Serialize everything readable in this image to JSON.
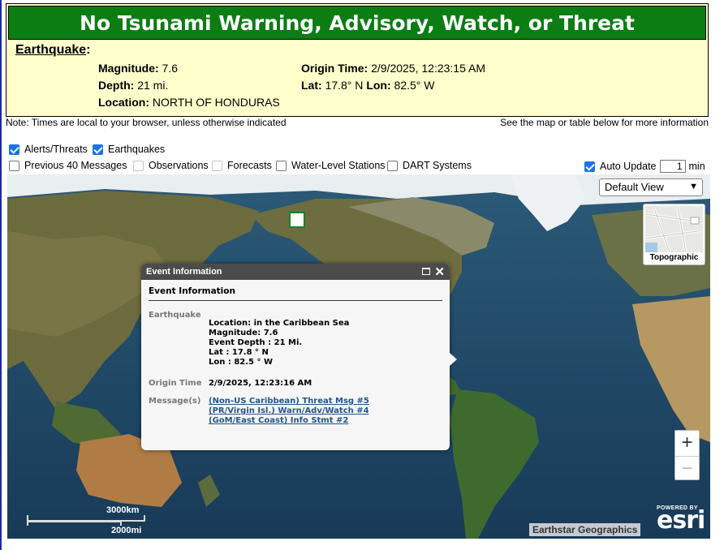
{
  "banner": {
    "title": "No Tsunami Warning, Advisory, Watch, or Threat",
    "earthquake_label": "Earthquake",
    "magnitude_label": "Magnitude:",
    "magnitude": "7.6",
    "depth_label": "Depth:",
    "depth": "21 mi.",
    "location_label": "Location:",
    "location": "NORTH OF HONDURAS",
    "origin_time_label": "Origin Time:",
    "origin_time": "2/9/2025, 12:23:15 AM",
    "lat_label": "Lat:",
    "lat": "17.8° N",
    "lon_label": "Lon:",
    "lon": "82.5° W"
  },
  "notes": {
    "left": "Note: Times are local to your browser, unless otherwise indicated",
    "right": "See the map or table below for more information"
  },
  "layers": {
    "alerts": {
      "label": "Alerts/Threats",
      "checked": true
    },
    "earthquakes": {
      "label": "Earthquakes",
      "checked": true
    },
    "previous": {
      "label": "Previous 40 Messages",
      "checked": false
    },
    "observations": {
      "label": "Observations",
      "checked": false
    },
    "forecasts": {
      "label": "Forecasts",
      "checked": false
    },
    "water_level": {
      "label": "Water-Level Stations",
      "checked": false
    },
    "dart": {
      "label": "DART Systems",
      "checked": false
    }
  },
  "auto_update": {
    "label": "Auto Update",
    "checked": true,
    "value": "1",
    "unit": "min"
  },
  "map": {
    "basemap_selected": "Default View",
    "topo_label": "Topographic",
    "zoom_in": "+",
    "zoom_out": "−",
    "scale_km": "3000km",
    "scale_mi": "2000mi",
    "attribution": "Earthstar Geographics",
    "esri_powered": "POWERED BY",
    "esri_logo": "esri",
    "ocean_color": "#1f4766",
    "land_color": "#6b6a3e"
  },
  "popup": {
    "header": "Event Information",
    "title": "Event Information",
    "eq_key": "Earthquake",
    "eq_lines": [
      "Location: in the Caribbean Sea",
      "Magnitude: 7.6",
      "Event Depth : 21 Mi.",
      "Lat : 17.8 ° N",
      "Lon : 82.5 ° W"
    ],
    "origin_key": "Origin Time",
    "origin_val": "2/9/2025, 12:23:16 AM",
    "messages_key": "Message(s)",
    "messages": [
      "(Non-US Caribbean) Threat Msg #5",
      "(PR/Virgin Isl.) Warn/Adv/Watch #4",
      "(GoM/East Coast) Info Stmt #2"
    ]
  }
}
